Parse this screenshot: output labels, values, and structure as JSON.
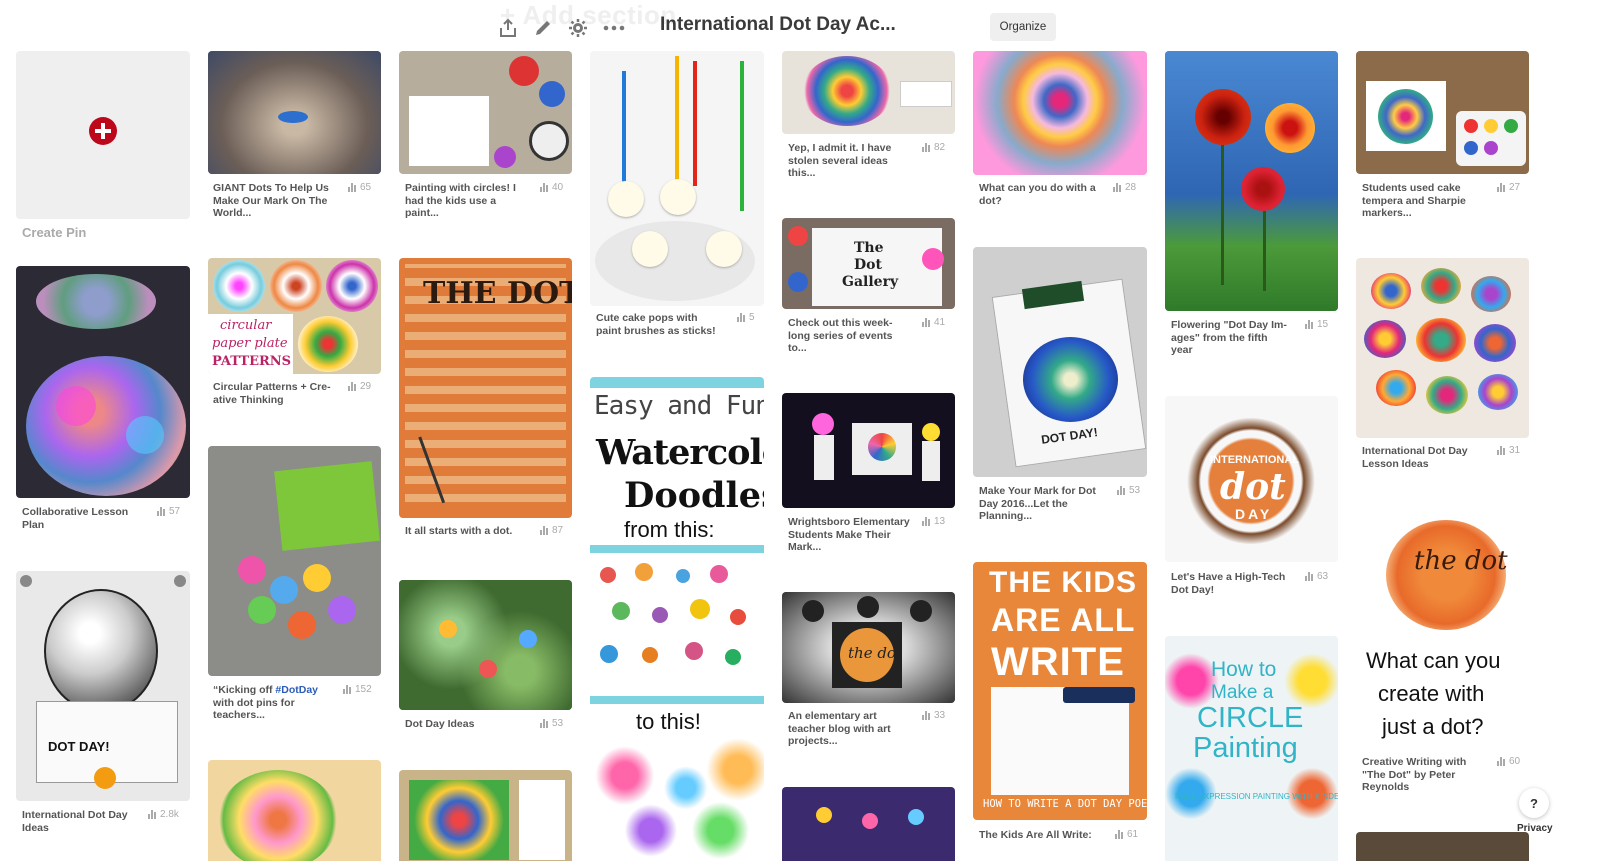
{
  "header": {
    "ghost_text": "+ Add section",
    "board_title": "International Dot Day Ac...",
    "organize_label": "Organize",
    "icons": [
      "share-icon",
      "edit-icon",
      "settings-icon",
      "more-icon"
    ]
  },
  "create_pin": {
    "label": "Create Pin"
  },
  "image_text": {
    "the_dot": "THE DOT",
    "dot_gallery_1": "The",
    "dot_gallery_2": "Dot",
    "dot_gallery_3": "Gallery",
    "circular_1": "circular",
    "circular_2": "paper plate",
    "circular_3": "PATTERNS",
    "easy_fun": "Easy and Fun",
    "watercolor": "Watercolor",
    "doodles": "Doodles",
    "from_this": "from this:",
    "to_this": "to this!",
    "kids_1": "THE KIDS",
    "kids_2": "ARE ALL",
    "kids_3": "WRITE",
    "kids_4": "HOW TO WRITE A DOT DAY POEM",
    "circle_1": "How to",
    "circle_2": "Make a",
    "circle_3": "CIRCLE",
    "circle_4": "Painting",
    "circle_5": "FREE EXPRESSION PAINTING WITH KINDERS",
    "intl_1": "INTERNATIONAL",
    "intl_2": "dot",
    "intl_3": "DAY",
    "what_1": "What can you",
    "what_2": "create with",
    "what_3": "just a dot?",
    "the_dot_2": "the dot",
    "dotday_label": "DOT DAY!",
    "dotday_label_2": "DOT DAY!"
  },
  "pins": [
    {
      "desc": "Collaborative Lesson\nPlan",
      "count": "57"
    },
    {
      "desc": "International Dot Day\nIdeas",
      "count": "2.8k"
    },
    {
      "desc": "GIANT Dots To Help Us\nMake Our Mark On The\nWorld...",
      "count": "65"
    },
    {
      "desc": "Circular Patterns + Cre-\native Thinking",
      "count": "29"
    },
    {
      "desc": "“Kicking off ",
      "hashtag": "#DotDay",
      "desc_rest": "\nwith dot pins for\nteachers...",
      "count": "152"
    },
    {
      "desc": "Painting with circles! I\nhad the kids use a\npaint...",
      "count": "40"
    },
    {
      "desc": "It all starts with a dot.",
      "count": "87"
    },
    {
      "desc": "Dot Day Ideas",
      "count": "53"
    },
    {
      "desc": "Cute cake pops with\npaint brushes as sticks!",
      "count": "5"
    },
    {
      "desc": "Yep, I admit it. I have\nstolen several ideas\nthis...",
      "count": "82"
    },
    {
      "desc": "Check out this week-\nlong series of events\nto...",
      "count": "41"
    },
    {
      "desc": "Wrightsboro Elementary\nStudents Make Their\nMark...",
      "count": "13"
    },
    {
      "desc": "An elementary art\nteacher blog with art\nprojects...",
      "count": "33"
    },
    {
      "desc": "What can you do with a\ndot?",
      "count": "28"
    },
    {
      "desc": "Make Your Mark for Dot\nDay 2016...Let the\nPlanning...",
      "count": "53"
    },
    {
      "desc": "The Kids Are All Write:",
      "count": "61"
    },
    {
      "desc": "Flowering \"Dot Day Im-\nages\" from the fifth\nyear",
      "count": "15"
    },
    {
      "desc": "Let's Have a High-Tech\nDot Day!",
      "count": "63"
    },
    {
      "desc": "Students used cake\ntempera and Sharpie\nmarkers...",
      "count": "27"
    },
    {
      "desc": "International Dot Day\nLesson Ideas",
      "count": "31"
    },
    {
      "desc": "Creative Writing with\n\"The Dot\" by Peter\nReynolds",
      "count": "60"
    }
  ],
  "footer": {
    "help": "?",
    "privacy": "Privacy"
  },
  "colors": {
    "accent_red": "#bd081c",
    "text": "#555555",
    "muted": "#aaaaaa",
    "orange": "#e8873a"
  }
}
